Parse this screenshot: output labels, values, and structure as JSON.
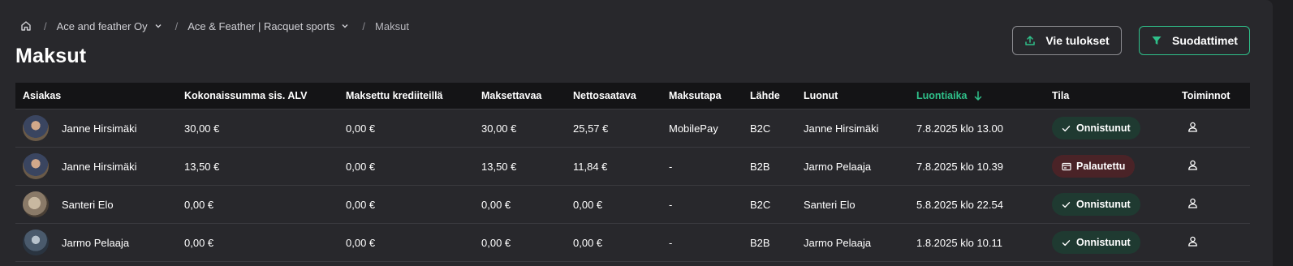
{
  "breadcrumb": {
    "home_icon": "home-icon",
    "items": [
      {
        "label": "Ace and feather Oy"
      },
      {
        "label": "Ace & Feather | Racquet sports"
      }
    ],
    "current": "Maksut"
  },
  "page_title": "Maksut",
  "toolbar": {
    "export_label": "Vie tulokset",
    "export_icon": "upload-icon",
    "filter_label": "Suodattimet",
    "filter_icon": "filter-icon"
  },
  "colors": {
    "accent": "#2fc08a",
    "success_badge": "#1f3a31",
    "refund_badge": "#4a2327"
  },
  "table": {
    "headers": [
      "Asiakas",
      "Kokonaissumma sis. ALV",
      "Maksettu krediiteillä",
      "Maksettavaa",
      "Nettosaatava",
      "Maksutapa",
      "Lähde",
      "Luonut",
      "Luontiaika",
      "Tila",
      "Toiminnot"
    ],
    "sorted_column": "Luontiaika",
    "sort_direction": "descending",
    "rows": [
      {
        "customer": "Janne Hirsimäki",
        "total": "30,00 €",
        "credits": "0,00 €",
        "payable": "30,00 €",
        "net": "25,57 €",
        "method": "MobilePay",
        "source": "B2C",
        "created_by": "Janne Hirsimäki",
        "created_at": "7.8.2025 klo 13.00",
        "status": "Onnistunut",
        "status_type": "success"
      },
      {
        "customer": "Janne Hirsimäki",
        "total": "13,50 €",
        "credits": "0,00 €",
        "payable": "13,50 €",
        "net": "11,84 €",
        "method": "-",
        "source": "B2B",
        "created_by": "Jarmo Pelaaja",
        "created_at": "7.8.2025 klo 10.39",
        "status": "Palautettu",
        "status_type": "refunded"
      },
      {
        "customer": "Santeri Elo",
        "total": "0,00 €",
        "credits": "0,00 €",
        "payable": "0,00 €",
        "net": "0,00 €",
        "method": "-",
        "source": "B2C",
        "created_by": "Santeri Elo",
        "created_at": "5.8.2025 klo 22.54",
        "status": "Onnistunut",
        "status_type": "success"
      },
      {
        "customer": "Jarmo Pelaaja",
        "total": "0,00 €",
        "credits": "0,00 €",
        "payable": "0,00 €",
        "net": "0,00 €",
        "method": "-",
        "source": "B2B",
        "created_by": "Jarmo Pelaaja",
        "created_at": "1.8.2025 klo 10.11",
        "status": "Onnistunut",
        "status_type": "success"
      }
    ]
  }
}
